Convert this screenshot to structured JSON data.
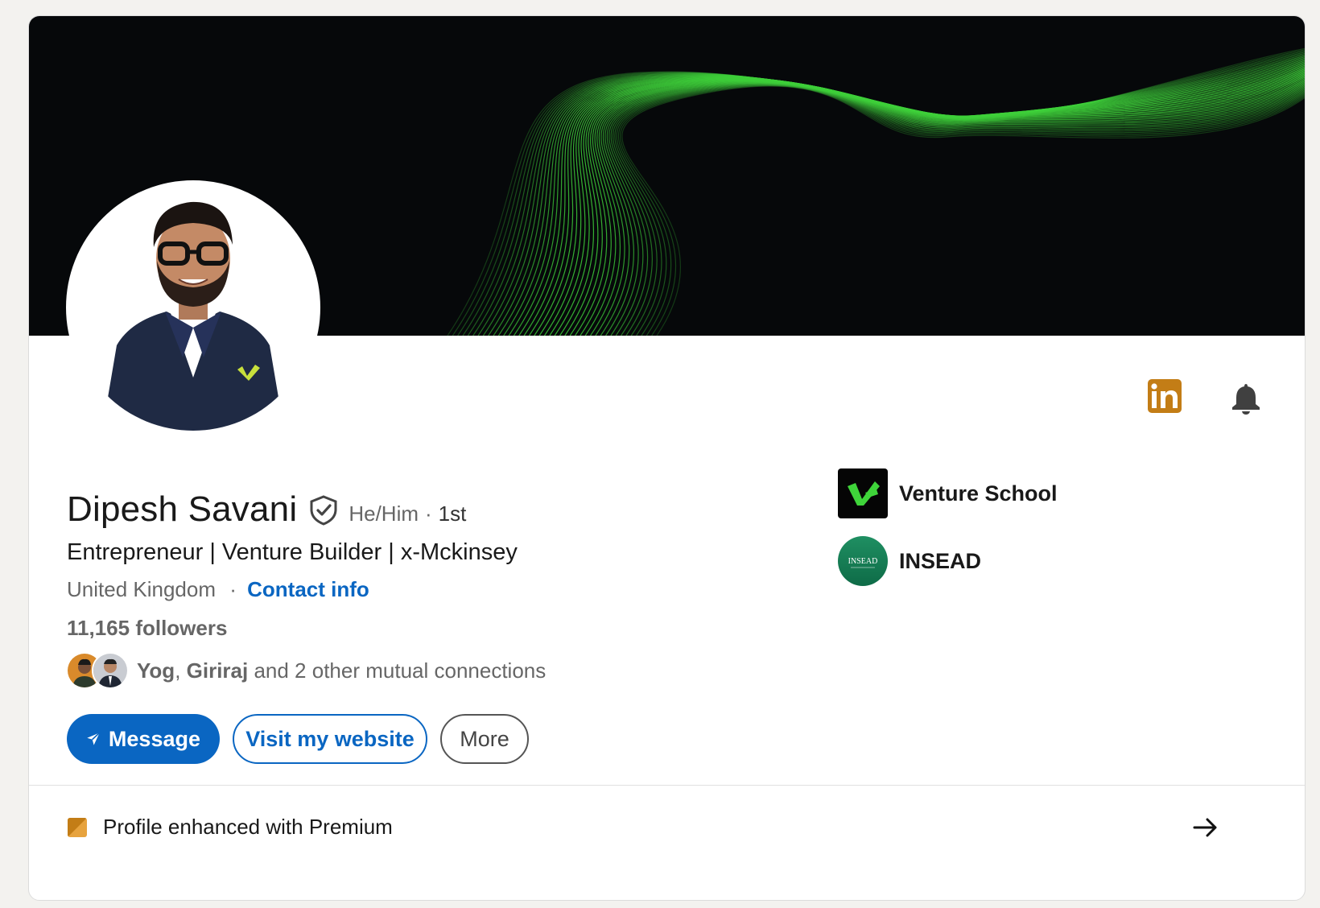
{
  "profile": {
    "name": "Dipesh Savani",
    "pronouns": "He/Him",
    "degree": "1st",
    "headline": "Entrepreneur | Venture Builder | x-Mckinsey",
    "location": "United Kingdom",
    "contact_label": "Contact info",
    "followers": "11,165 followers"
  },
  "mutual": {
    "name1": "Yog",
    "separator": ", ",
    "name2": "Giriraj",
    "rest": " and 2 other mutual connections"
  },
  "actions": {
    "message": "Message",
    "website": "Visit my website",
    "more": "More"
  },
  "organizations": [
    {
      "name": "Venture School",
      "icon": "venture-school-logo"
    },
    {
      "name": "INSEAD",
      "icon": "insead-logo",
      "logo_text": "INSEAD"
    }
  ],
  "premium": {
    "text": "Profile enhanced with Premium"
  },
  "icons": {
    "top_right": [
      "linkedin-premium-icon",
      "bell-icon"
    ],
    "verified": "verified-shield-icon",
    "arrow": "arrow-right-icon"
  },
  "colors": {
    "accent": "#0a66c2",
    "premium": "#c37d16",
    "banner": "#06080a",
    "wave": "#3ecf3a"
  }
}
